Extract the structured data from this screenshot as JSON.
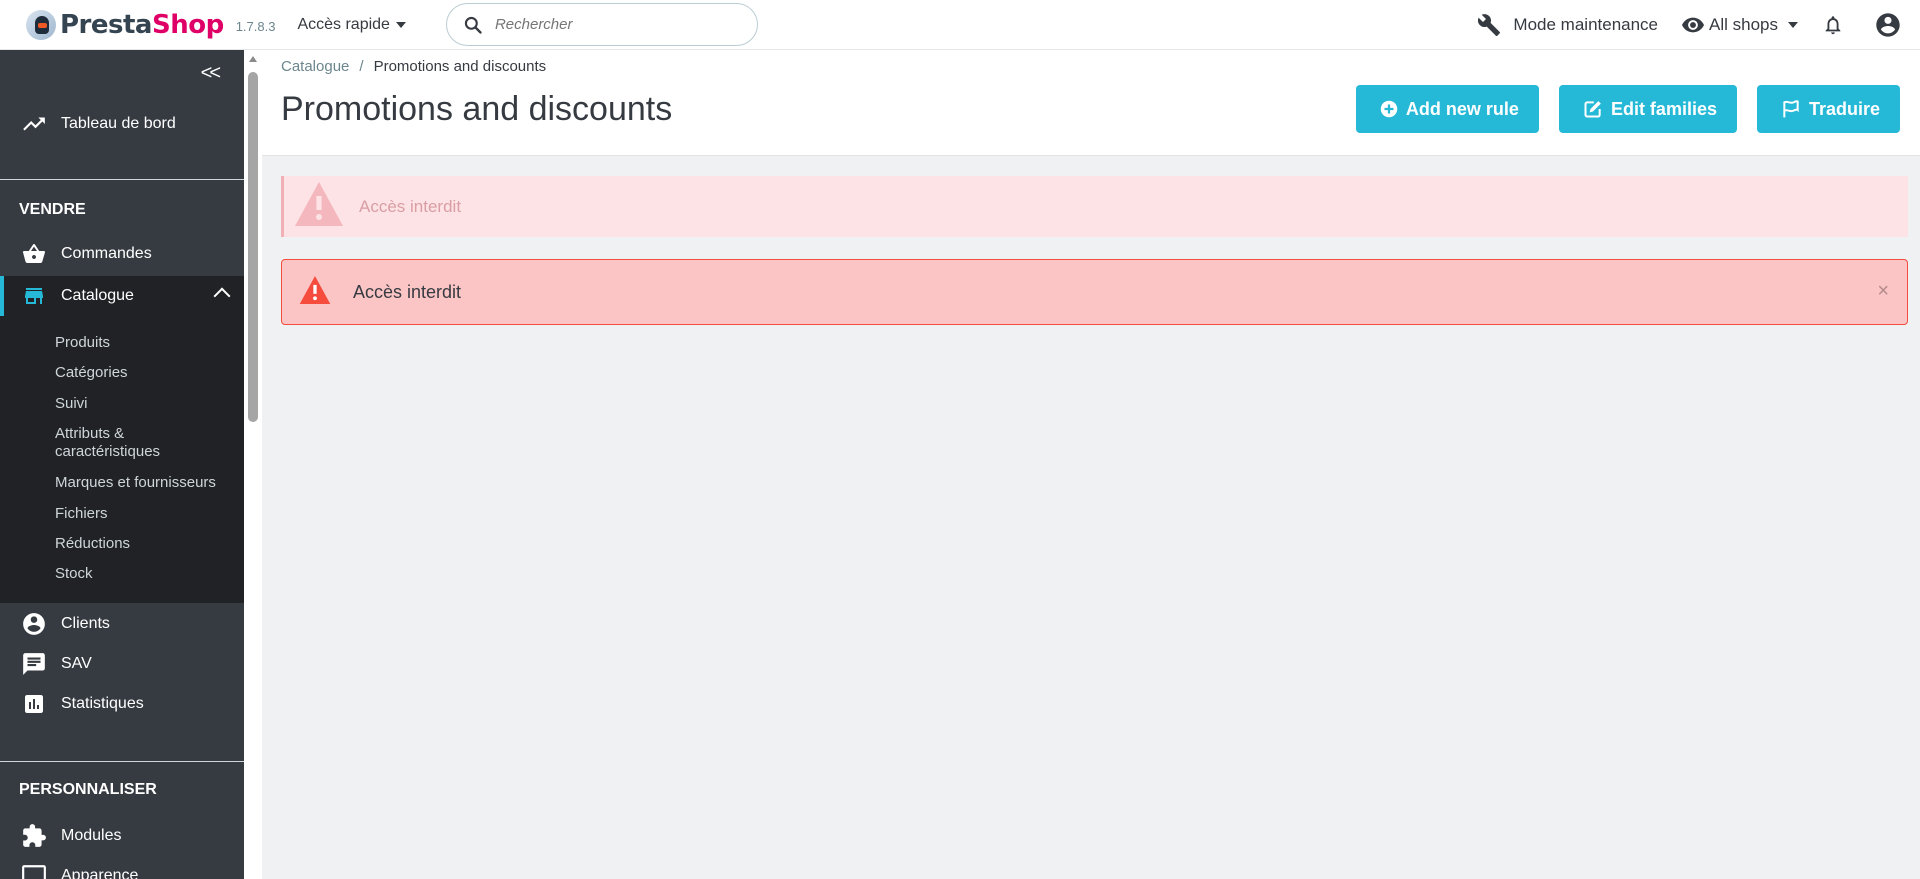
{
  "header": {
    "logo_presta": "Presta",
    "logo_shop": "Shop",
    "version": "1.7.8.3",
    "quick_access": "Accès rapide",
    "search_placeholder": "Rechercher",
    "maintenance": "Mode maintenance",
    "shops": "All shops"
  },
  "sidebar": {
    "dashboard": "Tableau de bord",
    "sell_title": "VENDRE",
    "orders": "Commandes",
    "catalog": "Catalogue",
    "catalog_items": [
      "Produits",
      "Catégories",
      "Suivi",
      "Attributs &",
      "caractéristiques",
      "Marques et fournisseurs",
      "Fichiers",
      "Réductions",
      "Stock"
    ],
    "customers": "Clients",
    "support": "SAV",
    "stats": "Statistiques",
    "customize_title": "PERSONNALISER",
    "modules": "Modules",
    "appearance": "Apparence"
  },
  "breadcrumb": {
    "parent": "Catalogue",
    "separator": "/",
    "current": "Promotions and discounts"
  },
  "page": {
    "title": "Promotions and discounts",
    "buttons": {
      "add_rule": "Add new rule",
      "edit_families": "Edit families",
      "translate": "Traduire"
    }
  },
  "alerts": {
    "faded": "Accès interdit",
    "main": "Accès interdit",
    "close": "×"
  },
  "colors": {
    "primary": "#25b9d7",
    "sidebar": "#363a41",
    "sidebar_active": "#202226",
    "danger": "#f54c3e",
    "danger_bg": "#fcc5c5",
    "brand_pink": "#df0067"
  }
}
